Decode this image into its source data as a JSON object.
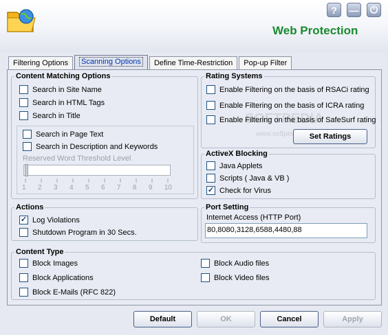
{
  "app": {
    "title": "Web Protection"
  },
  "window_buttons": {
    "help": "?",
    "minimize": "—",
    "power": "⏻"
  },
  "tabs": [
    {
      "label": "Filtering Options"
    },
    {
      "label": "Scanning Options"
    },
    {
      "label": "Define Time-Restriction"
    },
    {
      "label": "Pop-up Filter"
    }
  ],
  "content_matching": {
    "title": "Content Matching Options",
    "items": [
      {
        "label": "Search in Site Name",
        "checked": false
      },
      {
        "label": "Search in HTML Tags",
        "checked": false
      },
      {
        "label": "Search in Title",
        "checked": false
      }
    ],
    "page_items": [
      {
        "label": "Search in Page Text",
        "checked": false
      },
      {
        "label": "Search in Description and Keywords",
        "checked": false
      }
    ],
    "threshold_label": "Reserved Word Threshold Level",
    "ticks": [
      "1",
      "2",
      "3",
      "4",
      "5",
      "6",
      "7",
      "8",
      "9",
      "10"
    ]
  },
  "rating_systems": {
    "title": "Rating Systems",
    "items": [
      {
        "label": "Enable Filtering on the basis of RSACi rating",
        "checked": false
      },
      {
        "label": "Enable Filtering on the basis of ICRA rating",
        "checked": false
      },
      {
        "label": "Enable Filtering on the basis of SafeSurf rating",
        "checked": false
      }
    ],
    "button": "Set Ratings"
  },
  "activex": {
    "title": "ActiveX Blocking",
    "items": [
      {
        "label": "Java Applets",
        "checked": false
      },
      {
        "label": "Scripts ( Java & VB )",
        "checked": false
      },
      {
        "label": "Check for Virus",
        "checked": true
      }
    ]
  },
  "actions": {
    "title": "Actions",
    "items": [
      {
        "label": "Log Violations",
        "checked": true
      },
      {
        "label": "Shutdown Program in 30 Secs.",
        "checked": false
      }
    ]
  },
  "port_setting": {
    "title": "Port Setting",
    "label": "Internet Access (HTTP Port)",
    "value": "80,8080,3128,6588,4480,88"
  },
  "content_type": {
    "title": "Content Type",
    "left": [
      {
        "label": "Block Images",
        "checked": false
      },
      {
        "label": "Block Applications",
        "checked": false
      },
      {
        "label": "Block E-Mails (RFC 822)",
        "checked": false
      }
    ],
    "right": [
      {
        "label": "Block Audio files",
        "checked": false
      },
      {
        "label": "Block Video files",
        "checked": false
      }
    ]
  },
  "watermark": {
    "text": "SOFTPEDIA",
    "url": "www.softpedia.com"
  },
  "footer": {
    "default": "Default",
    "ok": "OK",
    "cancel": "Cancel",
    "apply": "Apply"
  }
}
